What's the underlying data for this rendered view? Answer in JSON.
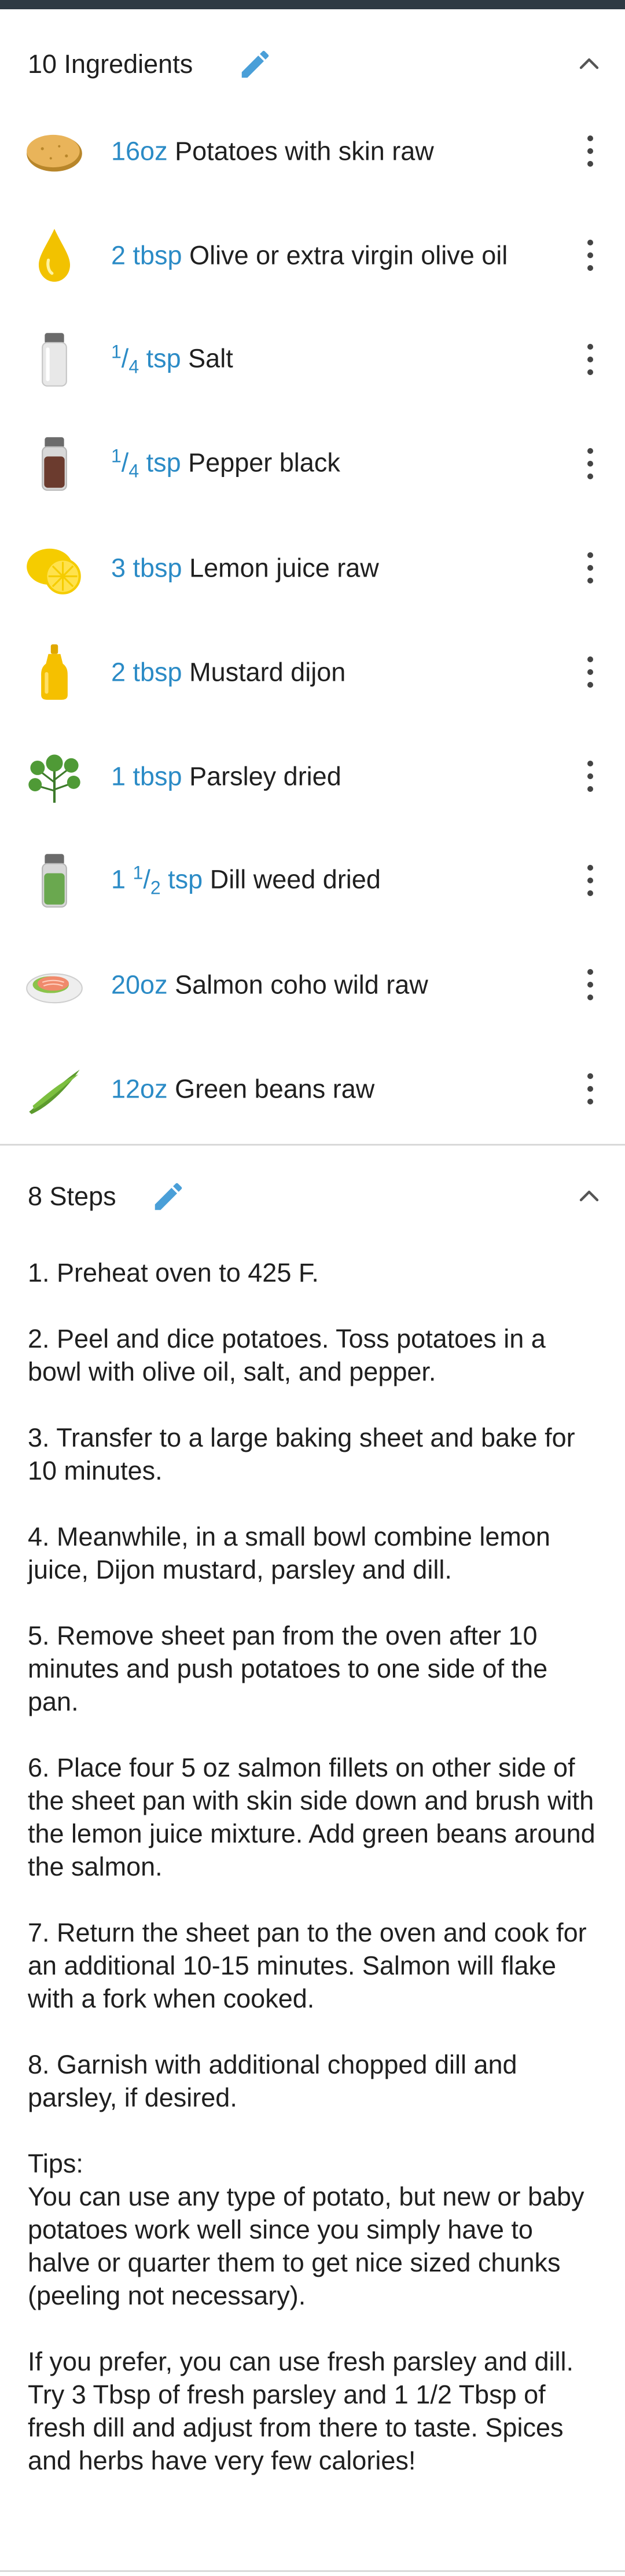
{
  "ingredients": {
    "title": "10 Ingredients",
    "items": [
      {
        "amount": "16oz",
        "name": "Potatoes with skin raw",
        "icon": "potato-icon"
      },
      {
        "amount": "2 tbsp",
        "name": "Olive or extra virgin olive oil",
        "icon": "oil-drop-icon"
      },
      {
        "amount_whole": "",
        "amount_num": "1",
        "amount_den": "4",
        "amount_unit": "tsp",
        "name": "Salt",
        "icon": "salt-shaker-icon"
      },
      {
        "amount_whole": "",
        "amount_num": "1",
        "amount_den": "4",
        "amount_unit": "tsp",
        "name": "Pepper black",
        "icon": "pepper-shaker-icon"
      },
      {
        "amount": "3 tbsp",
        "name": "Lemon juice raw",
        "icon": "lemon-icon"
      },
      {
        "amount": "2 tbsp",
        "name": "Mustard dijon",
        "icon": "mustard-bottle-icon"
      },
      {
        "amount": "1 tbsp",
        "name": "Parsley dried",
        "icon": "parsley-icon"
      },
      {
        "amount_whole": "1",
        "amount_num": "1",
        "amount_den": "2",
        "amount_unit": "tsp",
        "name": "Dill weed dried",
        "icon": "herb-jar-icon"
      },
      {
        "amount": "20oz",
        "name": "Salmon coho wild raw",
        "icon": "salmon-icon"
      },
      {
        "amount": "12oz",
        "name": "Green beans raw",
        "icon": "green-beans-icon"
      }
    ]
  },
  "steps": {
    "title": "8 Steps",
    "items": [
      "1. Preheat oven to 425 F.",
      "2. Peel and dice potatoes.  Toss potatoes in a bowl with olive oil, salt, and pepper.",
      "3. Transfer to a large baking sheet and bake for 10 minutes.",
      "4. Meanwhile, in a small bowl combine lemon juice, Dijon mustard, parsley and dill.",
      "5. Remove sheet pan from the oven after 10 minutes and push potatoes to one side of the pan.",
      "6. Place four 5 oz salmon fillets on other side of the sheet pan with skin side down and brush with the lemon juice mixture. Add green beans around the salmon.",
      "7. Return the sheet pan to the oven and cook for an additional 10-15 minutes. Salmon will flake with a fork when cooked.",
      "8. Garnish with additional chopped dill and parsley, if desired."
    ],
    "tips_label": "Tips:",
    "tips": [
      "You can use any type of potato, but new or baby potatoes work well since you simply have to halve or quarter them to get nice sized chunks (peeling not necessary).",
      "If you prefer, you can use fresh parsley and dill.  Try 3 Tbsp of fresh parsley and 1 1/2 Tbsp of fresh dill and adjust from there to taste.  Spices and herbs have very few calories!"
    ]
  },
  "colors": {
    "accent": "#2b8bc6",
    "edit_icon": "#4a9fd8",
    "text": "#1f1f1f",
    "divider": "#d9d9d9",
    "top_strip": "#2e3a44"
  }
}
